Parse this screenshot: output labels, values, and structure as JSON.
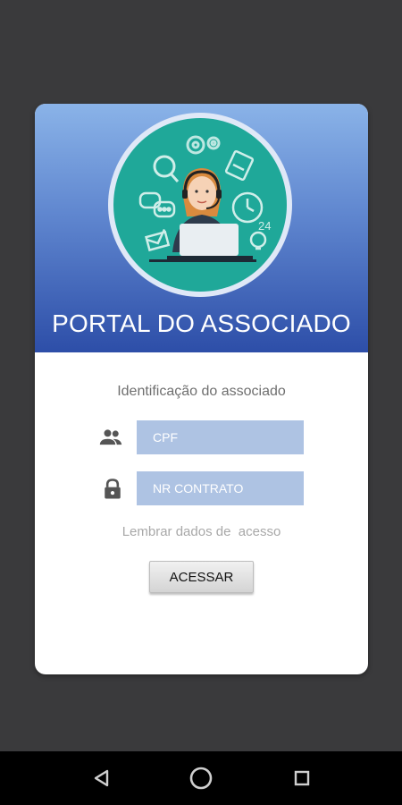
{
  "header": {
    "title": "PORTAL DO ASSOCIADO",
    "illustration_label": "24"
  },
  "form": {
    "subtitle": "Identificação do associado",
    "cpf_placeholder": "CPF",
    "contract_placeholder": "NR CONTRATO",
    "remember_label": "Lembrar dados de  acesso",
    "submit_label": "ACESSAR"
  },
  "icons": {
    "user": "users-icon",
    "lock": "lock-icon",
    "nav_back": "back-icon",
    "nav_home": "home-icon",
    "nav_recents": "recents-icon"
  },
  "colors": {
    "background": "#3a3a3c",
    "header_top": "#8ab3e8",
    "header_bottom": "#2d4ea8",
    "teal": "#1fa899",
    "input_bg": "#aec3e3"
  }
}
